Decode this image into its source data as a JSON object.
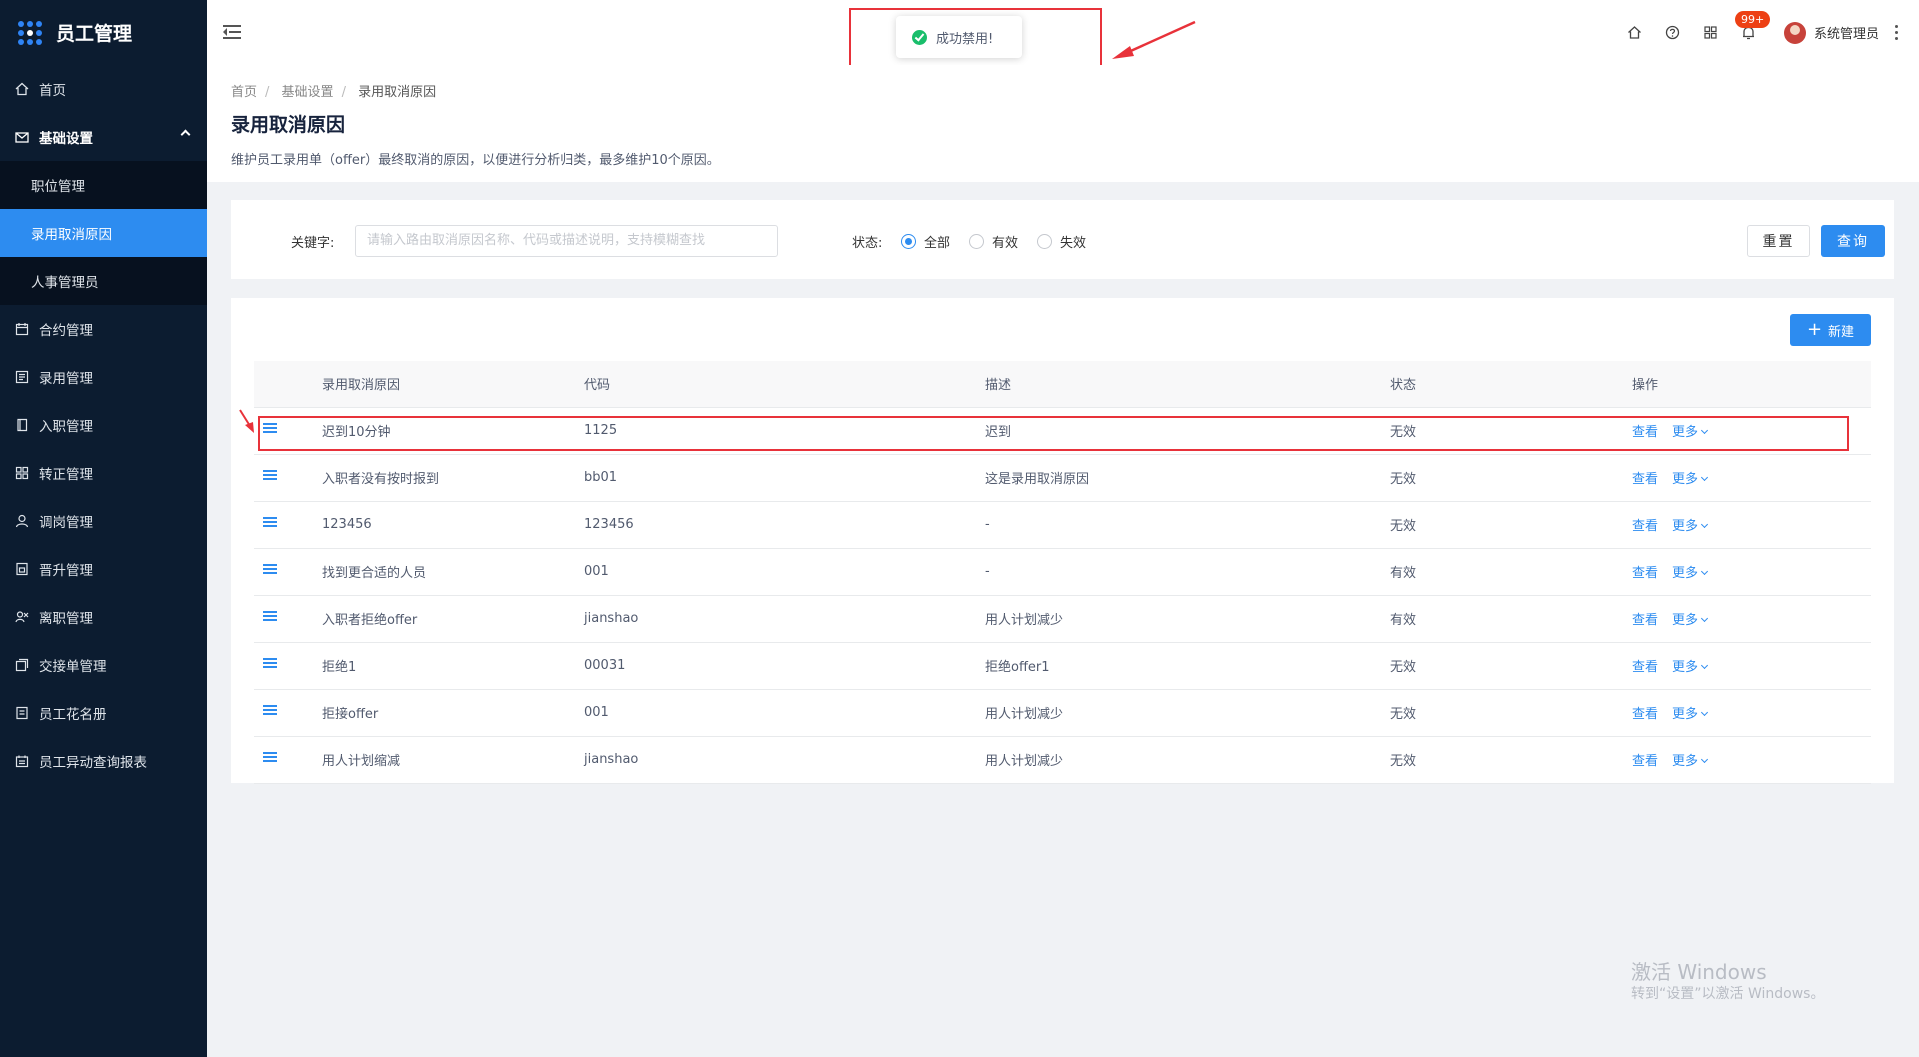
{
  "app": {
    "title": "员工管理"
  },
  "sidebar": {
    "items": [
      {
        "label": "首页",
        "icon": "home-icon"
      },
      {
        "label": "基础设置",
        "icon": "mail-icon",
        "expanded": true,
        "children": [
          {
            "label": "职位管理",
            "active": false
          },
          {
            "label": "录用取消原因",
            "active": true
          },
          {
            "label": "人事管理员",
            "active": false
          }
        ]
      },
      {
        "label": "合约管理",
        "icon": "calendar-icon"
      },
      {
        "label": "录用管理",
        "icon": "form-icon"
      },
      {
        "label": "入职管理",
        "icon": "book-icon"
      },
      {
        "label": "转正管理",
        "icon": "grid-icon"
      },
      {
        "label": "调岗管理",
        "icon": "user-icon"
      },
      {
        "label": "晋升管理",
        "icon": "doc-icon"
      },
      {
        "label": "离职管理",
        "icon": "people-icon"
      },
      {
        "label": "交接单管理",
        "icon": "copy-icon"
      },
      {
        "label": "员工花名册",
        "icon": "roster-icon"
      },
      {
        "label": "员工异动查询报表",
        "icon": "report-icon"
      }
    ]
  },
  "header": {
    "notification_count": "99+",
    "username": "系统管理员"
  },
  "toast": {
    "message": "成功禁用!",
    "status_color": "#19be6b"
  },
  "page": {
    "breadcrumb": [
      "首页",
      "基础设置",
      "录用取消原因"
    ],
    "title": "录用取消原因",
    "description": "维护员工录用单（offer）最终取消的原因，以便进行分析归类，最多维护10个原因。"
  },
  "filter": {
    "keyword_label": "关键字:",
    "keyword_placeholder": "请输入路由取消原因名称、代码或描述说明，支持模糊查找",
    "status_label": "状态:",
    "status_options": [
      "全部",
      "有效",
      "失效"
    ],
    "status_selected": "全部",
    "reset_label": "重置",
    "query_label": "查询"
  },
  "table": {
    "new_label": "新建",
    "columns": [
      "录用取消原因",
      "代码",
      "描述",
      "状态",
      "操作"
    ],
    "view_label": "查看",
    "more_label": "更多",
    "rows": [
      {
        "reason": "迟到10分钟",
        "code": "1125",
        "desc": "迟到",
        "status": "无效"
      },
      {
        "reason": "入职者没有按时报到",
        "code": "bb01",
        "desc": "这是录用取消原因",
        "status": "无效"
      },
      {
        "reason": "123456",
        "code": "123456",
        "desc": "-",
        "status": "无效"
      },
      {
        "reason": "找到更合适的人员",
        "code": "001",
        "desc": "-",
        "status": "有效"
      },
      {
        "reason": "入职者拒绝offer",
        "code": "jianshao",
        "desc": "用人计划减少",
        "status": "有效"
      },
      {
        "reason": "拒绝1",
        "code": "00031",
        "desc": "拒绝offer1",
        "status": "无效"
      },
      {
        "reason": "拒接offer",
        "code": "001",
        "desc": "用人计划减少",
        "status": "无效"
      },
      {
        "reason": "用人计划缩减",
        "code": "jianshao",
        "desc": "用人计划减少",
        "status": "无效"
      }
    ]
  },
  "watermark": {
    "line1": "激活 Windows",
    "line2": "转到“设置”以激活 Windows。"
  },
  "colors": {
    "primary": "#2d8cf0",
    "sidebar_bg": "#0c1c30",
    "annotation_red": "#e8323a"
  }
}
